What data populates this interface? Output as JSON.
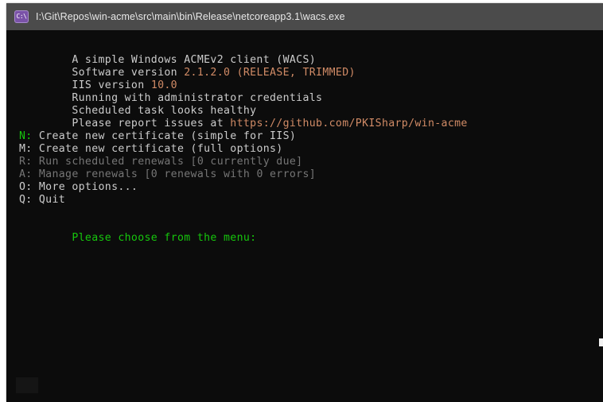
{
  "window": {
    "icon_name": "console-app-icon",
    "icon_glyph": "C:\\",
    "title": "I:\\Git\\Repos\\win-acme\\src\\main\\bin\\Release\\netcoreapp3.1\\wacs.exe"
  },
  "colors": {
    "terminal_background": "#0c0c0c",
    "titlebar_background": "#4b4b4b",
    "default_text": "#cccccc",
    "accent_text": "#d18b66",
    "green_text": "#16c60c",
    "dim_text": "#767676",
    "icon_purple": "#7a52a8"
  },
  "terminal": {
    "header": {
      "app_tagline": "A simple Windows ACMEv2 client (WACS)",
      "software_version_label": "Software version ",
      "software_version_value": "2.1.2.0 (RELEASE, TRIMMED)",
      "iis_version_label": "IIS version ",
      "iis_version_value": "10.0",
      "credentials_line": "Running with administrator credentials",
      "scheduled_task_line": "Scheduled task looks healthy",
      "report_issues_label": "Please report issues at ",
      "report_issues_url": "https://github.com/PKISharp/win-acme"
    },
    "menu": [
      {
        "key": "N:",
        "key_color": "green",
        "label": " Create new certificate (simple for IIS)",
        "label_color": "default"
      },
      {
        "key": "M:",
        "key_color": "default",
        "label": " Create new certificate (full options)",
        "label_color": "default"
      },
      {
        "key": "R:",
        "key_color": "dim",
        "label": " Run scheduled renewals [0 currently due]",
        "label_color": "dim"
      },
      {
        "key": "A:",
        "key_color": "dim",
        "label": " Manage renewals [0 renewals with 0 errors]",
        "label_color": "dim"
      },
      {
        "key": "O:",
        "key_color": "default",
        "label": " More options...",
        "label_color": "default"
      },
      {
        "key": "Q:",
        "key_color": "default",
        "label": " Quit",
        "label_color": "default"
      }
    ],
    "prompt": "Please choose from the menu:"
  }
}
